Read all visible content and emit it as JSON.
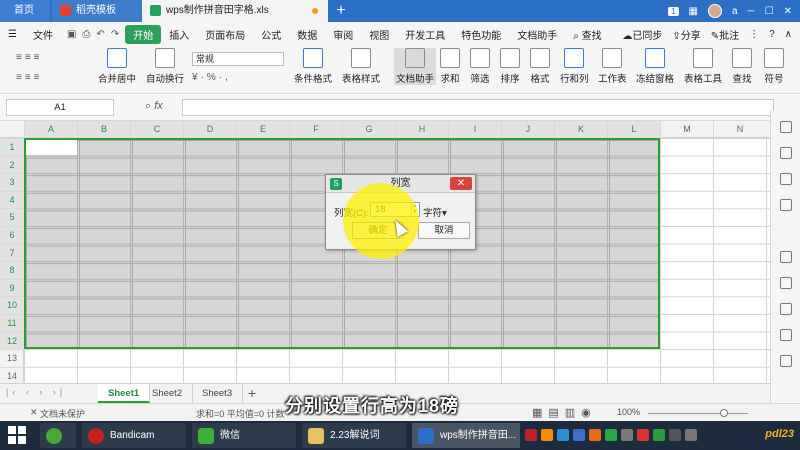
{
  "tabs": {
    "home": "首页",
    "daoke": "稻壳模板",
    "document": "wps制作拼音田字格.xls",
    "new_tab": "+",
    "badge": "1",
    "user": "a"
  },
  "menu": {
    "file": "文件",
    "items": [
      "开始",
      "插入",
      "页面布局",
      "公式",
      "数据",
      "审阅",
      "视图",
      "开发工具",
      "特色功能",
      "文档助手"
    ],
    "search": "查找",
    "sync": "已同步",
    "share": "分享",
    "comment": "批注"
  },
  "ribbon": {
    "number_format": "常规",
    "merge_center": "合并居中",
    "wrap_text": "自动换行",
    "cond_format": "条件格式",
    "table_style": "表格样式",
    "doc_helper": "文档助手",
    "sum": "求和",
    "filter": "筛选",
    "sort": "排序",
    "format": "格式",
    "row_col": "行和列",
    "worksheet": "工作表",
    "freeze": "冻结窗格",
    "table_tools": "表格工具",
    "find": "查找",
    "symbol": "符号"
  },
  "formula_bar": {
    "cell_ref": "A1",
    "fx": "fx",
    "content": ""
  },
  "grid": {
    "columns": [
      "A",
      "B",
      "C",
      "D",
      "E",
      "F",
      "G",
      "H",
      "I",
      "J",
      "K",
      "L",
      "M",
      "N"
    ],
    "rows": [
      "1",
      "2",
      "3",
      "4",
      "5",
      "6",
      "7",
      "8",
      "9",
      "10",
      "11",
      "12",
      "13",
      "14"
    ]
  },
  "dialog": {
    "title": "列宽",
    "label": "列宽(C):",
    "value": "18",
    "unit": "字符",
    "ok": "确定",
    "cancel": "取消"
  },
  "sheets": {
    "tabs": [
      "Sheet1",
      "Sheet2",
      "Sheet3"
    ],
    "active": "Sheet1",
    "add": "+"
  },
  "status": {
    "protect": "文档未保护",
    "summary": "求和=0  平均值=0  计数",
    "zoom": "100%"
  },
  "subtitle": "分别设置行高为18磅",
  "taskbar": {
    "bandicam": "Bandicam",
    "wechat": "微信",
    "folder": "2.23解说词",
    "wps": "wps制作拼音田..."
  },
  "watermark": "pdl23",
  "colors": {
    "accent_blue": "#2b6fc7",
    "accent_green": "#2da05a",
    "selection_border": "#2ca02c",
    "highlight_yellow": "#fff000"
  }
}
